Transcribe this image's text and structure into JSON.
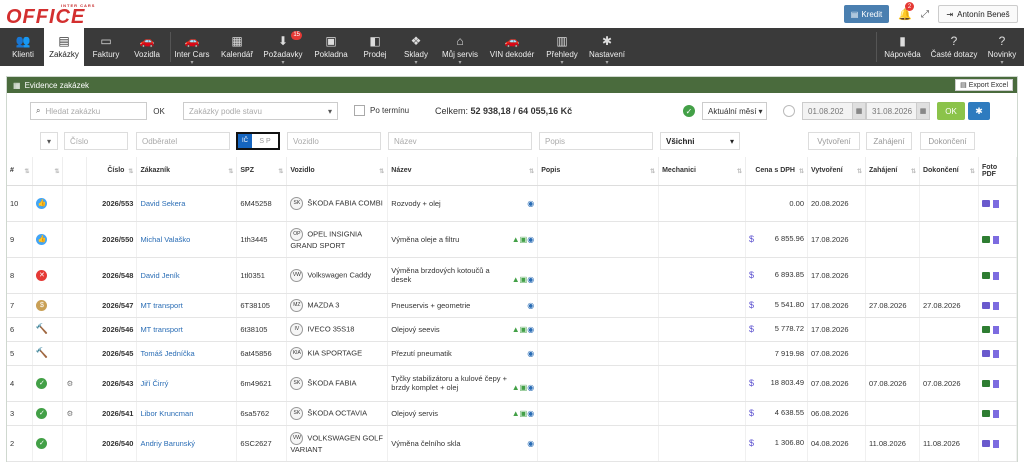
{
  "header": {
    "logo_top": "INTER CARS",
    "logo_main": "OFFICE",
    "kredit_label": "Kredit",
    "notif_count": "2",
    "user_name": "Antonín Beneš"
  },
  "nav": {
    "items": [
      {
        "label": "Klienti",
        "icon": "users-icon"
      },
      {
        "label": "Zakázky",
        "icon": "orders-icon"
      },
      {
        "label": "Faktury",
        "icon": "invoice-icon"
      },
      {
        "label": "Vozidla",
        "icon": "car-icon"
      },
      {
        "label": "Inter Cars",
        "icon": "car-icon"
      },
      {
        "label": "Kalendář",
        "icon": "calendar-icon"
      },
      {
        "label": "Požadavky",
        "icon": "download-icon",
        "badge": "15"
      },
      {
        "label": "Pokladna",
        "icon": "cash-icon"
      },
      {
        "label": "Prodej",
        "icon": "box-icon"
      },
      {
        "label": "Sklady",
        "icon": "boxes-icon"
      },
      {
        "label": "Můj servis",
        "icon": "home-icon"
      },
      {
        "label": "VIN dekodér",
        "icon": "car-icon"
      },
      {
        "label": "Přehledy",
        "icon": "chart-icon"
      },
      {
        "label": "Nastavení",
        "icon": "gear-icon"
      }
    ],
    "right": [
      {
        "label": "Nápověda",
        "icon": "book-icon"
      },
      {
        "label": "Časté dotazy",
        "icon": "question-icon"
      },
      {
        "label": "Novinky",
        "icon": "question-icon"
      }
    ]
  },
  "panel": {
    "title": "Evidence zakázek",
    "export_label": "Export Excel"
  },
  "toolbar": {
    "search_placeholder": "Hledat zakázku",
    "ok_label": "OK",
    "stav_placeholder": "Zakázky podle stavu",
    "po_terminu": "Po termínu",
    "celkem_label": "Celkem:",
    "celkem_value": "52 938,18 / 64 055,16 Kč",
    "aktualni": "Aktuální měsí",
    "date_from": "01.08.202",
    "date_to": "31.08.2026",
    "ok_green": "OK"
  },
  "filters": {
    "cislo": "Číslo",
    "odberatel": "Odběratel",
    "toggle_left": "IČ",
    "toggle_right": "S P",
    "vozidlo": "Vozidlo",
    "nazev": "Název",
    "popis": "Popis",
    "vsechny": "Všichni",
    "vytvoreni": "Vytvoření",
    "zahajeni": "Zahájení",
    "dokonceni": "Dokončení"
  },
  "columns": {
    "num": "#",
    "cislo": "Číslo",
    "zakaznik": "Zákazník",
    "spz": "SPZ",
    "vozidlo": "Vozidlo",
    "nazev": "Název",
    "popis": "Popis",
    "mechanici": "Mechanici",
    "cena": "Cena s DPH",
    "vytvoreni": "Vytvoření",
    "zahajeni": "Zahájení",
    "dokonceni": "Dokončení",
    "foto": "Foto PDF"
  },
  "rows": [
    {
      "n": "10",
      "status": "thumb",
      "cislo": "2026/553",
      "zakaznik": "David Sekera",
      "spz": "6M45258",
      "brand": "SK",
      "vozidlo": "ŠKODA FABIA COMBI",
      "nazev": "Rozvody + olej",
      "cena": "0.00",
      "dollar": false,
      "vytvoreni": "20.08.2026",
      "zahajeni": "",
      "dokonceni": "",
      "tall": true,
      "persons": 0,
      "tool": false,
      "cam": "p"
    },
    {
      "n": "9",
      "status": "thumb",
      "cislo": "2026/550",
      "zakaznik": "Michal Valaško",
      "spz": "1th3445",
      "brand": "OP",
      "vozidlo": "OPEL INSIGNIA GRAND SPORT",
      "nazev": "Výměna oleje a filtru",
      "cena": "6 855.96",
      "dollar": true,
      "vytvoreni": "17.08.2026",
      "zahajeni": "",
      "dokonceni": "",
      "tall": true,
      "persons": 2,
      "tool": false,
      "cam": "g"
    },
    {
      "n": "8",
      "status": "x",
      "cislo": "2026/548",
      "zakaznik": "David Jeník",
      "spz": "1tl0351",
      "brand": "VW",
      "vozidlo": "Volkswagen Caddy",
      "nazev": "Výměna brzdových kotoučů a desek",
      "cena": "6 893.85",
      "dollar": true,
      "vytvoreni": "17.08.2026",
      "zahajeni": "",
      "dokonceni": "",
      "tall": true,
      "persons": 2,
      "tool": false,
      "cam": "g"
    },
    {
      "n": "7",
      "status": "money",
      "cislo": "2026/547",
      "zakaznik": "MT transport",
      "spz": "6T38105",
      "brand": "MZ",
      "vozidlo": "MAZDA 3",
      "nazev": "Pneuservis + geometrie",
      "cena": "5 541.80",
      "dollar": true,
      "vytvoreni": "17.08.2026",
      "zahajeni": "27.08.2026",
      "dokonceni": "27.08.2026",
      "tall": false,
      "persons": 0,
      "tool": false,
      "cam": "p"
    },
    {
      "n": "6",
      "status": "hammer",
      "cislo": "2026/546",
      "zakaznik": "MT transport",
      "spz": "6t38105",
      "brand": "IV",
      "vozidlo": "IVECO 35S18",
      "nazev": "Olejový seevis",
      "cena": "5 778.72",
      "dollar": true,
      "vytvoreni": "17.08.2026",
      "zahajeni": "",
      "dokonceni": "",
      "tall": false,
      "persons": 2,
      "tool": false,
      "cam": "g"
    },
    {
      "n": "5",
      "status": "hammer",
      "cislo": "2026/545",
      "zakaznik": "Tomáš Jedníčka",
      "spz": "6at45856",
      "brand": "KIA",
      "vozidlo": "KIA SPORTAGE",
      "nazev": "Přezutí pneumatik",
      "cena": "7 919.98",
      "dollar": false,
      "vytvoreni": "07.08.2026",
      "zahajeni": "",
      "dokonceni": "",
      "tall": false,
      "persons": 0,
      "tool": false,
      "cam": "p"
    },
    {
      "n": "4",
      "status": "ok",
      "cislo": "2026/543",
      "zakaznik": "Jiří Čirrý",
      "spz": "6m49621",
      "brand": "SK",
      "vozidlo": "ŠKODA FABIA",
      "nazev": "Tyčky stabilizátoru a kulové čepy + brzdy komplet + olej",
      "cena": "18 803.49",
      "dollar": true,
      "vytvoreni": "07.08.2026",
      "zahajeni": "07.08.2026",
      "dokonceni": "07.08.2026",
      "tall": true,
      "persons": 2,
      "tool": true,
      "cam": "g"
    },
    {
      "n": "3",
      "status": "ok",
      "cislo": "2026/541",
      "zakaznik": "Libor Kruncman",
      "spz": "6sa5762",
      "brand": "SK",
      "vozidlo": "ŠKODA OCTAVIA",
      "nazev": "Olejový servis",
      "cena": "4 638.55",
      "dollar": true,
      "vytvoreni": "06.08.2026",
      "zahajeni": "",
      "dokonceni": "",
      "tall": false,
      "persons": 2,
      "tool": true,
      "cam": "g"
    },
    {
      "n": "2",
      "status": "ok",
      "cislo": "2026/540",
      "zakaznik": "Andriy Barunský",
      "spz": "6SC2627",
      "brand": "VW",
      "vozidlo": "VOLKSWAGEN GOLF VARIANT",
      "nazev": "Výměna čelního skla",
      "cena": "1 306.80",
      "dollar": true,
      "vytvoreni": "04.08.2026",
      "zahajeni": "11.08.2026",
      "dokonceni": "11.08.2026",
      "tall": true,
      "persons": 0,
      "tool": false,
      "cam": "p"
    }
  ],
  "colors": {
    "nav_bg": "#3a3a3a",
    "panel_header": "#4a6b3d",
    "accent_blue": "#2a6db5",
    "ok_green": "#43a047",
    "danger": "#e53935"
  }
}
